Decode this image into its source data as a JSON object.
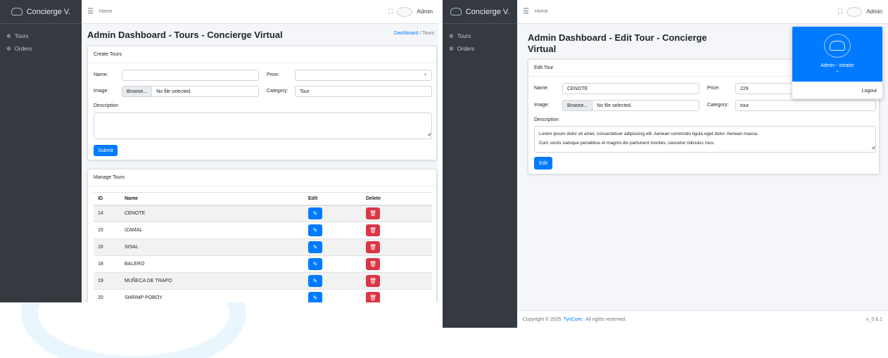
{
  "left": {
    "brand": "Concierge V.",
    "menu": [
      {
        "label": "Tours",
        "icon": "compass-icon"
      },
      {
        "label": "Orders",
        "icon": "compass-icon"
      }
    ],
    "topbar": {
      "breadcrumb": "Home",
      "user": "Admin"
    },
    "page_title": "Admin Dashboard - Tours - Concierge Virtual",
    "breadcrumb": {
      "link": "Dashboard",
      "separator": "/",
      "current": "Tours"
    },
    "create_card": {
      "title": "Create Tours",
      "name_label": "Name:",
      "name_value": "",
      "price_label": "Price:",
      "price_value": "",
      "image_label": "Image:",
      "browse_label": "Browse...",
      "file_text": "No file selected.",
      "category_label": "Category:",
      "category_value": "Tour",
      "description_label": "Description",
      "description_value": "",
      "submit_label": "Submit"
    },
    "manage_card": {
      "title": "Manage Tours",
      "columns": [
        "ID",
        "Name",
        "Edit",
        "Delete"
      ],
      "rows": [
        {
          "id": "14",
          "name": "CENOTE"
        },
        {
          "id": "15",
          "name": "IZAMAL"
        },
        {
          "id": "16",
          "name": "SISAL"
        },
        {
          "id": "18",
          "name": "BALERO"
        },
        {
          "id": "19",
          "name": "MUÑECA DE TRAPO"
        },
        {
          "id": "20",
          "name": "SHRIMP POBOY"
        }
      ]
    }
  },
  "right": {
    "brand": "Concierge V.",
    "menu": [
      {
        "label": "Tours",
        "icon": "compass-icon"
      },
      {
        "label": "Orders",
        "icon": "compass-icon"
      }
    ],
    "topbar": {
      "breadcrumb": "Home",
      "user": "Admin"
    },
    "page_title_line1": "Admin Dashboard - Edit Tour - Concierge",
    "page_title_line2": "Virtual",
    "edit_card": {
      "title": "Edit Tour",
      "name_label": "Name:",
      "name_value": "CENOTE",
      "price_label": "Price:",
      "price_value": "229",
      "image_label": "Image:",
      "browse_label": "Browse...",
      "file_text": "No file selected.",
      "category_label": "Category:",
      "category_value": "tour",
      "description_label": "Description",
      "description_line1": "Lorem ipsum dolor sit amet, consectetuer adipiscing elit. Aenean commodo ligula eget dolor. Aenean massa.",
      "description_line2": "Cum sociis natoque penatibus et magnis dis parturient montes, nascetur ridiculus mus.",
      "edit_label": "Edit"
    },
    "dropdown": {
      "role": "Admin - istrator",
      "dash": "–",
      "logout": "Logout"
    },
    "footer": {
      "prefix": "Copyright © 2025",
      "link": "TynCore.",
      "suffix": "All rights reserved.",
      "version": "v_0.6.1"
    }
  },
  "colors": {
    "primary": "#007bff",
    "danger": "#dc3545",
    "sidebar": "#343a40",
    "background": "#f4f6f9"
  }
}
